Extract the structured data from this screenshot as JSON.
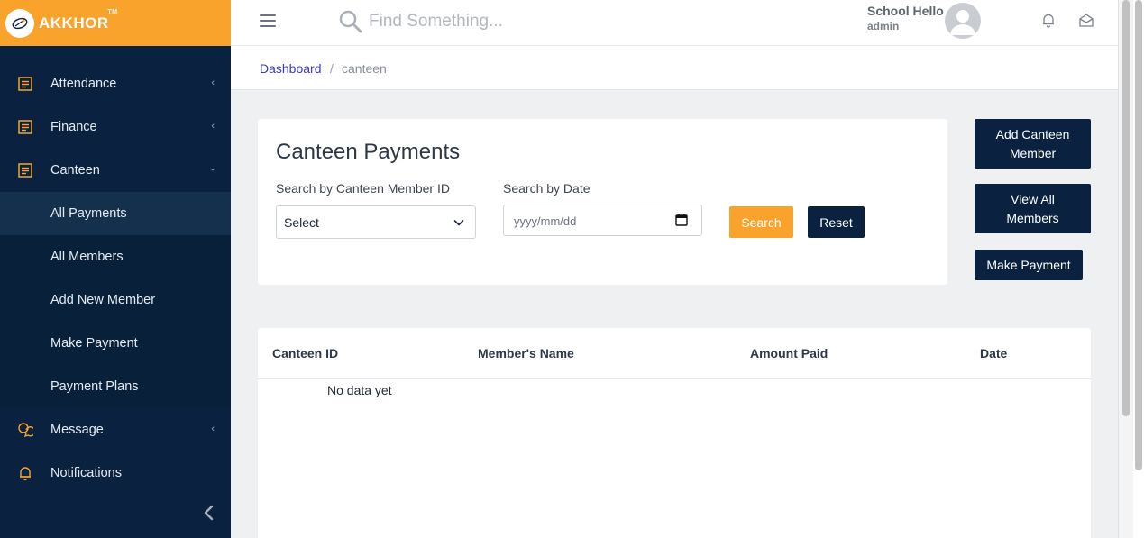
{
  "brand": {
    "name": "AKKHOR",
    "tm": "TM"
  },
  "sidebar": {
    "items": [
      {
        "label": "Attendance",
        "icon": "list-icon",
        "expanded": false
      },
      {
        "label": "Finance",
        "icon": "list-icon",
        "expanded": false
      },
      {
        "label": "Canteen",
        "icon": "list-icon",
        "expanded": true
      }
    ],
    "canteen_submenu": [
      {
        "label": "All Payments",
        "active": true
      },
      {
        "label": "All Members",
        "active": false
      },
      {
        "label": "Add New Member",
        "active": false
      },
      {
        "label": "Make Payment",
        "active": false
      },
      {
        "label": "Payment Plans",
        "active": false
      }
    ],
    "bottom_items": [
      {
        "label": "Message",
        "icon": "chat-icon",
        "expanded": false
      },
      {
        "label": "Notifications",
        "icon": "bell-icon"
      }
    ]
  },
  "header": {
    "search_placeholder": "Find Something...",
    "user_name": "School Hello",
    "user_role": "admin"
  },
  "breadcrumb": {
    "link": "Dashboard",
    "separator": "/",
    "current": "canteen"
  },
  "page": {
    "title": "Canteen Payments",
    "member_id_label": "Search by Canteen Member ID",
    "member_id_value": "Select",
    "date_label": "Search by Date",
    "date_placeholder": "yyyy/mm/dd",
    "search_button": "Search",
    "reset_button": "Reset"
  },
  "actions": {
    "add_member": "Add Canteen Member",
    "view_members": "View All Members",
    "make_payment": "Make Payment"
  },
  "table": {
    "headers": [
      "Canteen ID",
      "Member's Name",
      "Amount Paid",
      "Date"
    ],
    "empty_text": "No data yet"
  },
  "colors": {
    "sidebar": "#0a2240",
    "accent": "#f9a32c",
    "link": "#3a39c4"
  }
}
